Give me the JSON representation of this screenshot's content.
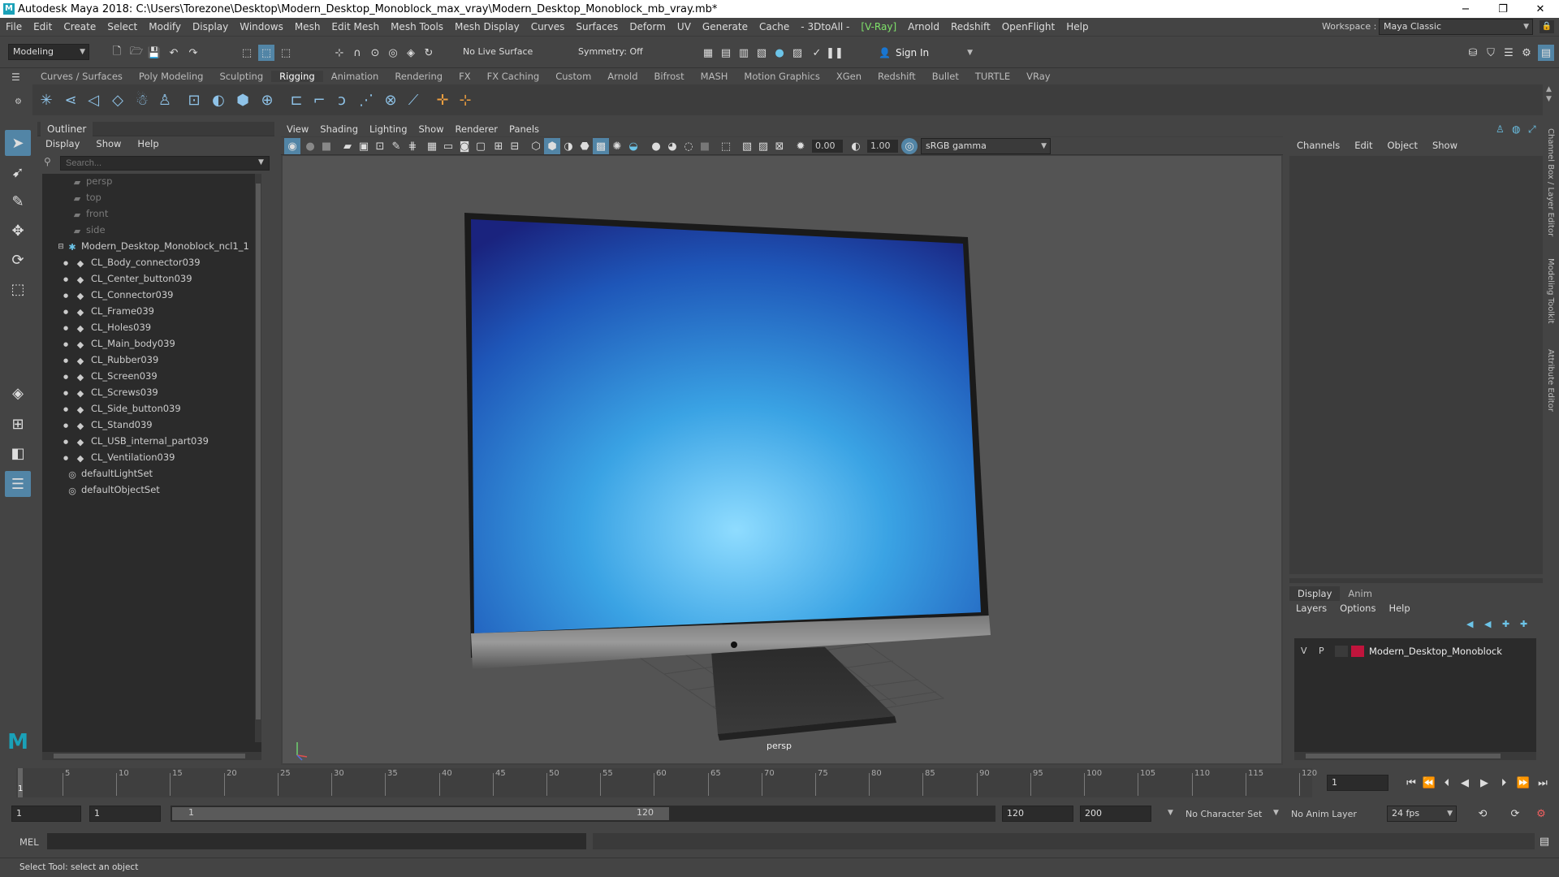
{
  "window": {
    "title": "Autodesk Maya 2018: C:\\Users\\Torezone\\Desktop\\Modern_Desktop_Monoblock_max_vray\\Modern_Desktop_Monoblock_mb_vray.mb*",
    "minimize": "−",
    "restore": "❐",
    "close": "✕"
  },
  "menubar": [
    "File",
    "Edit",
    "Create",
    "Select",
    "Modify",
    "Display",
    "Windows",
    "Mesh",
    "Edit Mesh",
    "Mesh Tools",
    "Mesh Display",
    "Curves",
    "Surfaces",
    "Deform",
    "UV",
    "Generate",
    "Cache",
    "- 3DtoAll -",
    "[V-Ray]",
    "Arnold",
    "Redshift",
    "OpenFlight",
    "Help"
  ],
  "workspace": {
    "label": "Workspace :",
    "value": "Maya Classic"
  },
  "status_line": {
    "mode": "Modeling",
    "live_surface": "No Live Surface",
    "symmetry": "Symmetry: Off",
    "sign_in": "Sign In"
  },
  "shelf_tabs": [
    "Curves / Surfaces",
    "Poly Modeling",
    "Sculpting",
    "Rigging",
    "Animation",
    "Rendering",
    "FX",
    "FX Caching",
    "Custom",
    "Arnold",
    "Bifrost",
    "MASH",
    "Motion Graphics",
    "XGen",
    "Redshift",
    "Bullet",
    "TURTLE",
    "VRay"
  ],
  "shelf_active": "Rigging",
  "outliner": {
    "title": "Outliner",
    "menu": [
      "Display",
      "Show",
      "Help"
    ],
    "search_placeholder": "Search...",
    "cameras": [
      "persp",
      "top",
      "front",
      "side"
    ],
    "root": "Modern_Desktop_Monoblock_ncl1_1",
    "children": [
      "CL_Body_connector039",
      "CL_Center_button039",
      "CL_Connector039",
      "CL_Frame039",
      "CL_Holes039",
      "CL_Main_body039",
      "CL_Rubber039",
      "CL_Screen039",
      "CL_Screws039",
      "CL_Side_button039",
      "CL_Stand039",
      "CL_USB_internal_part039",
      "CL_Ventilation039"
    ],
    "sets": [
      "defaultLightSet",
      "defaultObjectSet"
    ]
  },
  "viewport": {
    "menu": [
      "View",
      "Shading",
      "Lighting",
      "Show",
      "Renderer",
      "Panels"
    ],
    "exposure": "0.00",
    "gamma": "1.00",
    "color_space": "sRGB gamma",
    "camera_label": "persp"
  },
  "channel_box": {
    "menu": [
      "Channels",
      "Edit",
      "Object",
      "Show"
    ],
    "side_tabs": [
      "Channel Box / Layer Editor",
      "Modeling Toolkit",
      "Attribute Editor"
    ]
  },
  "layer_editor": {
    "tabs": [
      "Display",
      "Anim"
    ],
    "active_tab": "Display",
    "menu": [
      "Layers",
      "Options",
      "Help"
    ],
    "layers": [
      {
        "v": "V",
        "p": "P",
        "name": "Modern_Desktop_Monoblock",
        "color": "#c0143c"
      }
    ]
  },
  "timeline": {
    "ticks": [
      "1",
      "5",
      "10",
      "15",
      "20",
      "25",
      "30",
      "35",
      "40",
      "45",
      "50",
      "55",
      "60",
      "65",
      "70",
      "75",
      "80",
      "85",
      "90",
      "95",
      "100",
      "105",
      "110",
      "115",
      "120"
    ],
    "current_frame": "1"
  },
  "range": {
    "start": "1",
    "playback_start": "1",
    "slider_start": "1",
    "slider_end": "120",
    "playback_end": "120",
    "end": "200",
    "character_set": "No Character Set",
    "anim_layer": "No Anim Layer",
    "fps": "24 fps"
  },
  "command_line": {
    "label": "MEL"
  },
  "help_line": "Select Tool: select an object",
  "colors": {
    "accent": "#5285a6",
    "panel": "#444444",
    "field": "#2b2b2b",
    "vray": "#7fe26a"
  }
}
